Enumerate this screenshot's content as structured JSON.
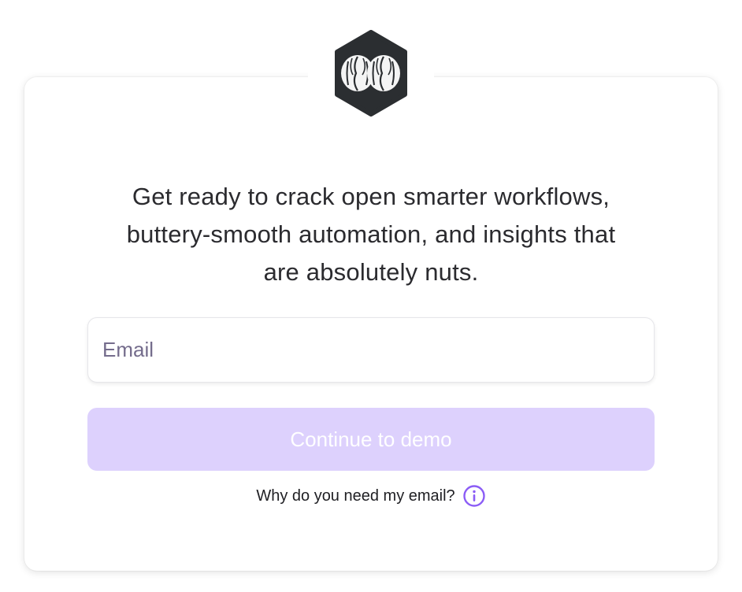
{
  "logo": {
    "icon": "walnut-logo-icon"
  },
  "tagline": {
    "line1": "Get ready to crack open smarter workflows,",
    "line2": "buttery-smooth automation, and insights that",
    "line3": "are absolutely nuts."
  },
  "form": {
    "email_placeholder": "Email",
    "email_value": "",
    "submit_label": "Continue to demo",
    "why_label": "Why do you need my email?",
    "info_icon": "info-icon"
  },
  "colors": {
    "accent": "#8b5cf6",
    "button_disabled_bg": "#ddd1fd",
    "logo_bg": "#2b2e31"
  }
}
